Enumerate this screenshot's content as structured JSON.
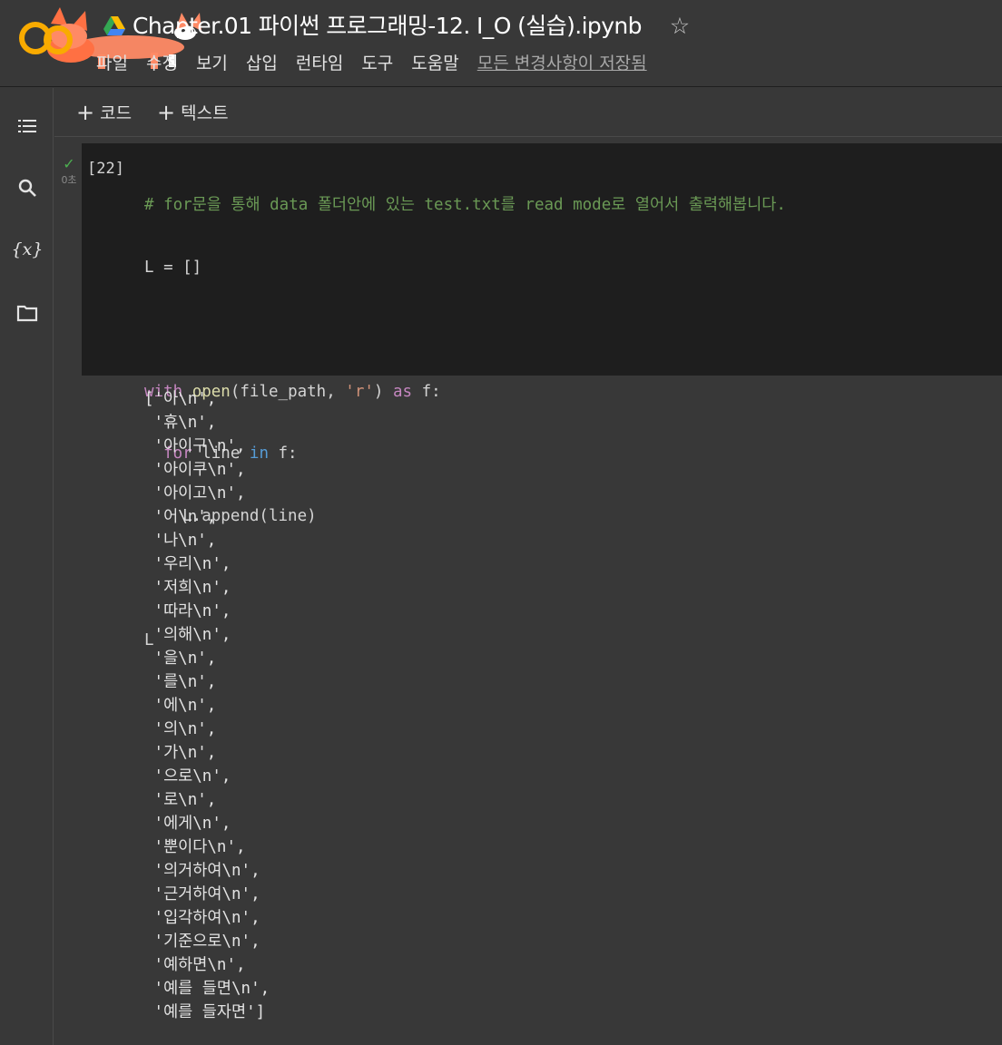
{
  "notebook": {
    "title": "Chapter.01 파이썬 프로그래밍-12. I_O (실습).ipynb",
    "star_icon": "star-outline-icon"
  },
  "menu": {
    "items": [
      "파일",
      "수정",
      "보기",
      "삽입",
      "런타임",
      "도구",
      "도움말"
    ],
    "saved_status": "모든 변경사항이 저장됨"
  },
  "toolbar": {
    "add_code_label": "코드",
    "add_text_label": "텍스트"
  },
  "sidebar": {
    "icons": [
      "table-of-contents-icon",
      "search-icon",
      "variables-icon",
      "files-folder-icon"
    ]
  },
  "cell": {
    "exec_count": "[22]",
    "exec_time": "0초",
    "status_color": "#4caf50",
    "code_lines": [
      "# for문을 통해 data 폴더안에 있는 test.txt를 read mode로 열어서 출력해봅니다.",
      "L = []",
      "",
      "with open(file_path, 'r') as f:",
      "  for line in f:",
      "    L.append(line)",
      "",
      "L"
    ],
    "output_lines": [
      "['아\\n',",
      " '휴\\n',",
      " '아이구\\n',",
      " '아이쿠\\n',",
      " '아이고\\n',",
      " '어\\n',",
      " '나\\n',",
      " '우리\\n',",
      " '저희\\n',",
      " '따라\\n',",
      " '의해\\n',",
      " '을\\n',",
      " '를\\n',",
      " '에\\n',",
      " '의\\n',",
      " '가\\n',",
      " '으로\\n',",
      " '로\\n',",
      " '에게\\n',",
      " '뿐이다\\n',",
      " '의거하여\\n',",
      " '근거하여\\n',",
      " '입각하여\\n',",
      " '기준으로\\n',",
      " '예하면\\n',",
      " '예를 들면\\n',",
      " '예를 들자면']"
    ]
  },
  "colors": {
    "background": "#383838",
    "code_background": "#1e1e1e",
    "comment": "#6a9955",
    "keyword": "#c586c0",
    "keyword_blue": "#569cd6",
    "function": "#dcdcaa",
    "string": "#ce9178"
  }
}
